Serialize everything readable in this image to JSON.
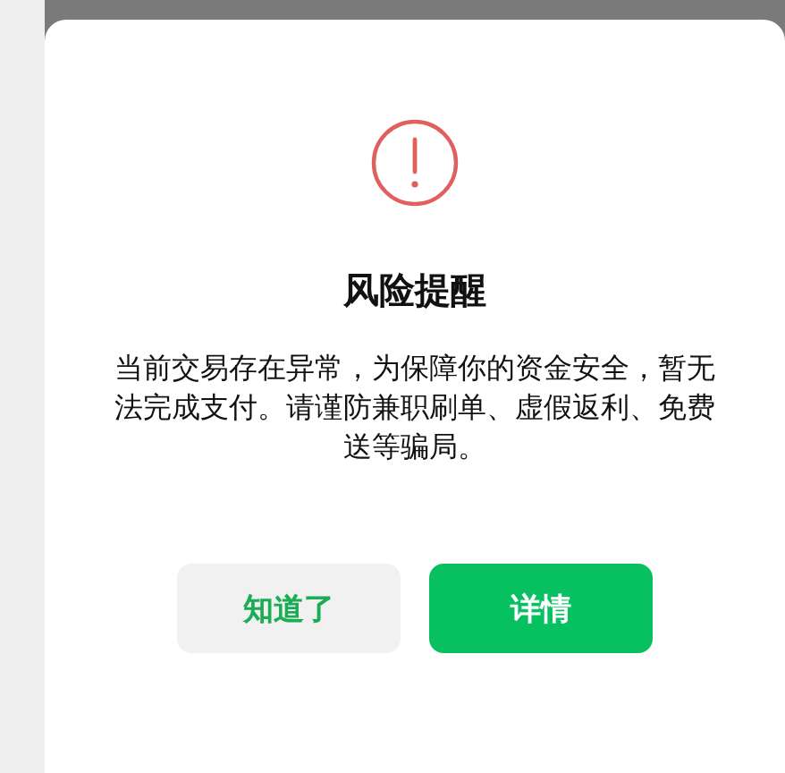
{
  "dialog": {
    "title": "风险提醒",
    "message": "当前交易存在异常，为保障你的资金安全，暂无法完成支付。请谨防兼职刷单、虚假返利、免费送等骗局。",
    "buttons": [
      {
        "label": "知道了",
        "kind": "secondary"
      },
      {
        "label": "详情",
        "kind": "primary"
      }
    ]
  }
}
